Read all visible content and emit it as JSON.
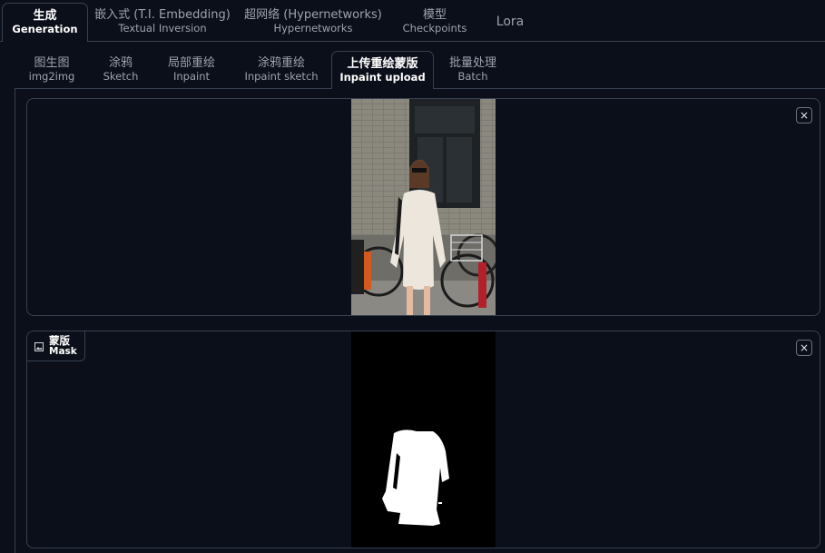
{
  "main_tabs": [
    {
      "zh": "生成",
      "en": "Generation"
    },
    {
      "zh": "嵌入式 (T.I. Embedding)",
      "en": "Textual Inversion"
    },
    {
      "zh": "超网络 (Hypernetworks)",
      "en": "Hypernetworks"
    },
    {
      "zh": "模型",
      "en": "Checkpoints"
    },
    {
      "zh": "Lora",
      "en": ""
    }
  ],
  "sub_tabs": [
    {
      "zh": "图生图",
      "en": "img2img"
    },
    {
      "zh": "涂鸦",
      "en": "Sketch"
    },
    {
      "zh": "局部重绘",
      "en": "Inpaint"
    },
    {
      "zh": "涂鸦重绘",
      "en": "Inpaint sketch"
    },
    {
      "zh": "上传重绘蒙版",
      "en": "Inpaint upload"
    },
    {
      "zh": "批量处理",
      "en": "Batch"
    }
  ],
  "image_panel": {
    "close_symbol": "×"
  },
  "mask_panel": {
    "label_zh": "蒙版",
    "label_en": "Mask",
    "close_symbol": "×"
  },
  "colors": {
    "background": "#0b0f19",
    "border": "#374151",
    "text_active": "#ffffff",
    "text_inactive": "#9ca3af"
  },
  "icons": [
    "image-icon",
    "close-icon"
  ]
}
